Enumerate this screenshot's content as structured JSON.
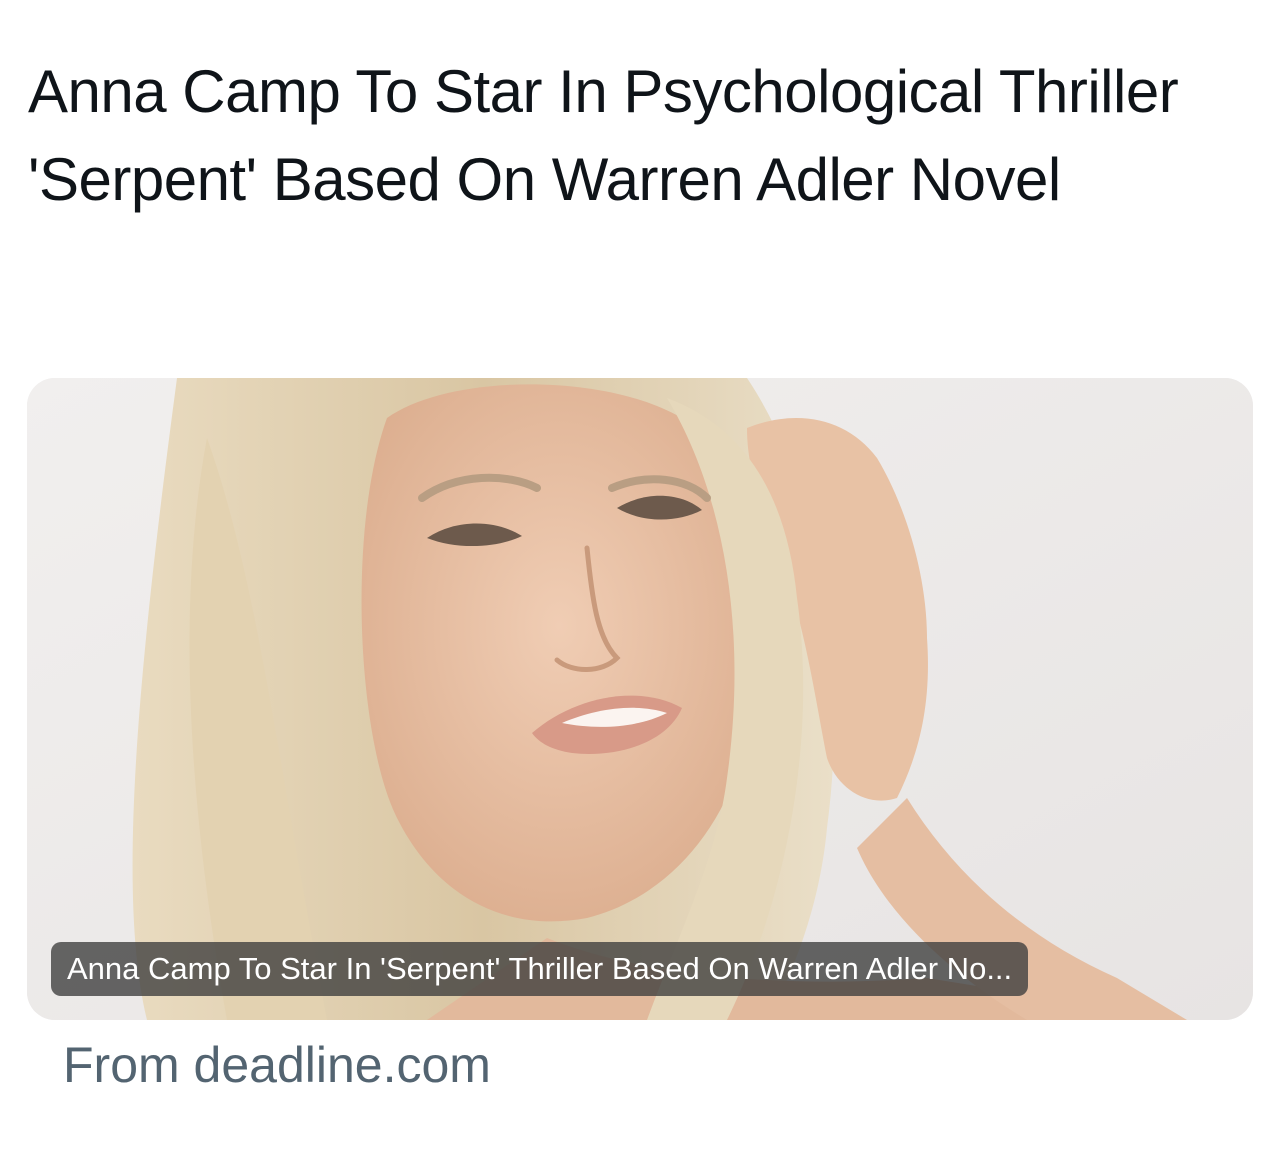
{
  "headline": "Anna Camp To Star In Psychological Thriller 'Serpent' Based On Warren Adler Novel",
  "card": {
    "image_caption": "Anna Camp To Star In 'Serpent' Thriller Based On Warren Adler No...",
    "source": "From deadline.com"
  },
  "colors": {
    "headline_text": "#0f1419",
    "source_text": "#536471",
    "caption_background": "#3c3c3c",
    "card_background": "#eceaea"
  }
}
